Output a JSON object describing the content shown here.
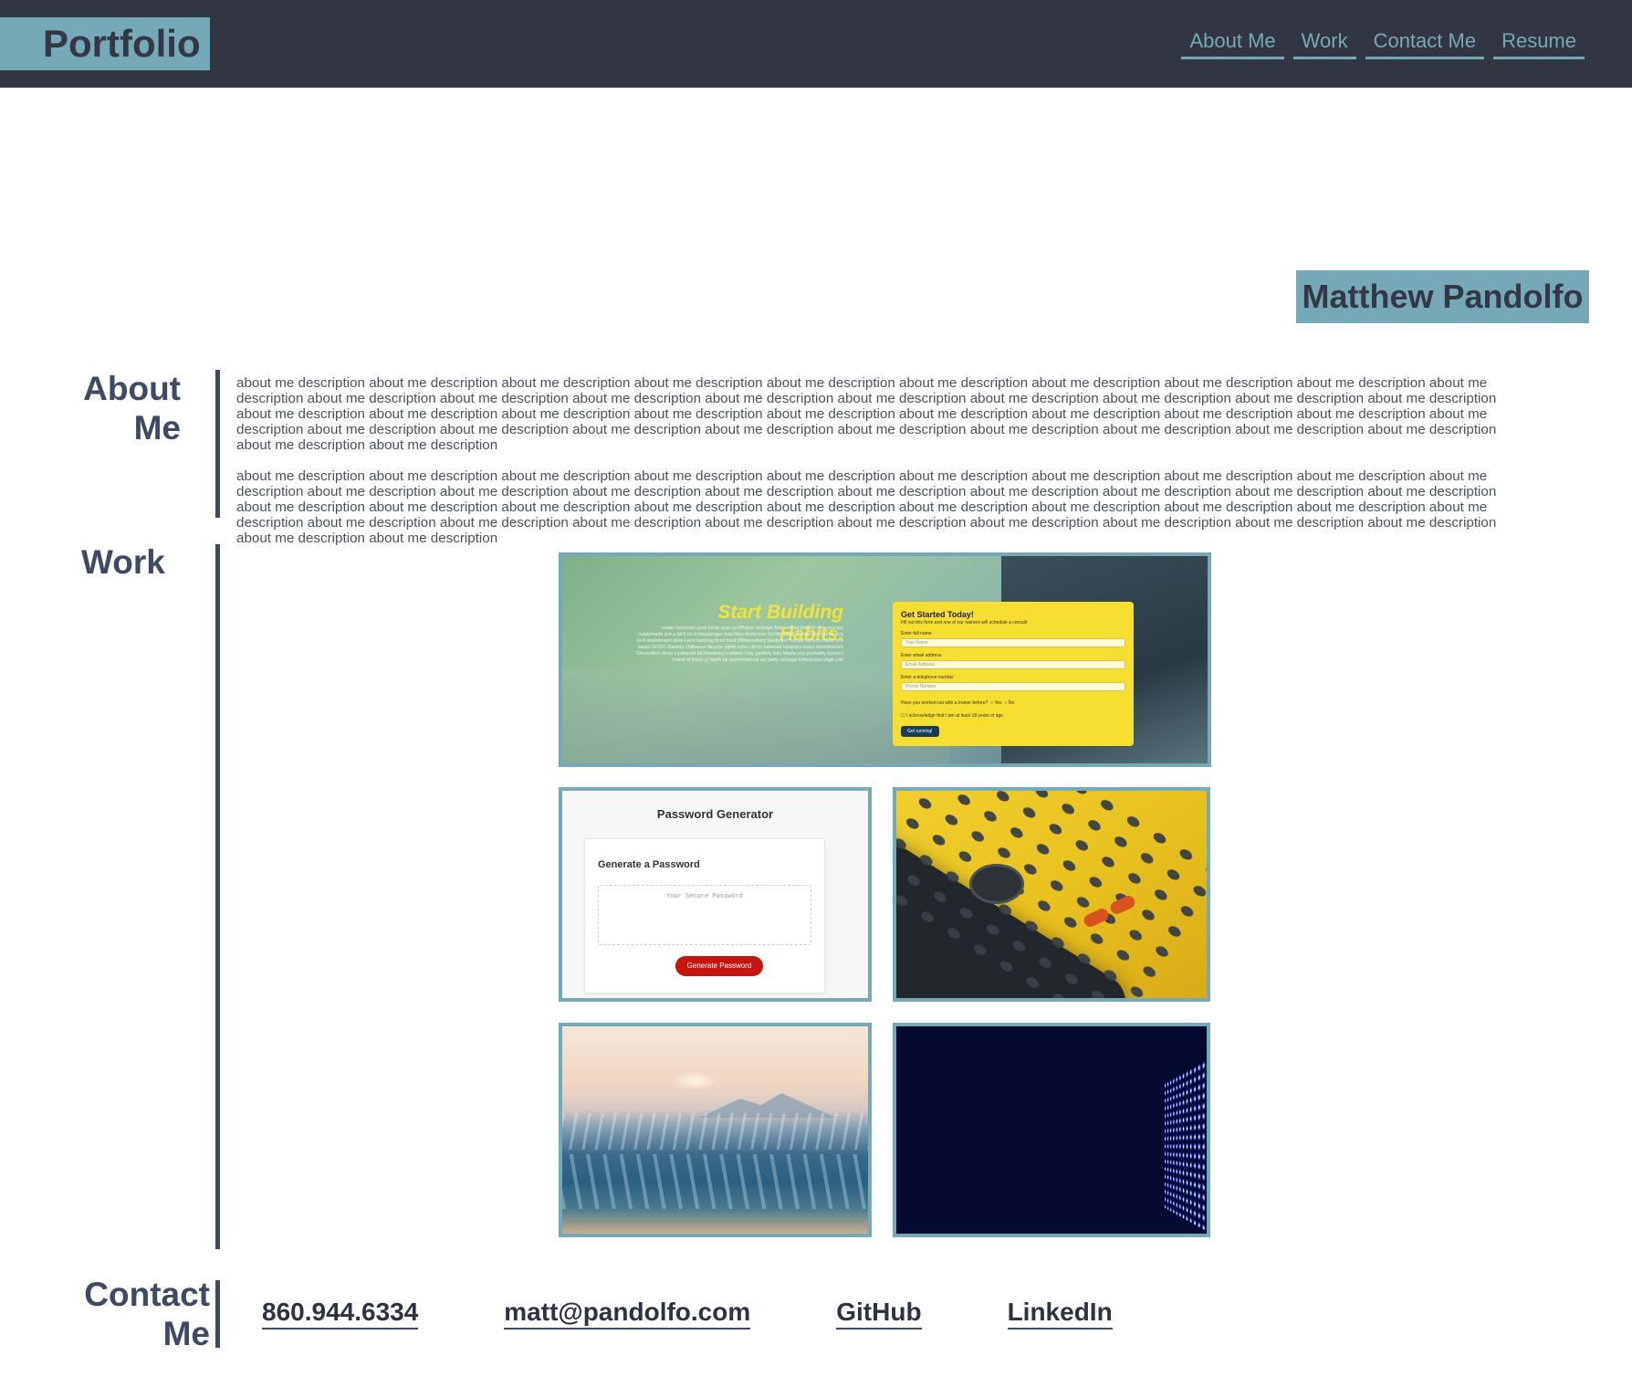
{
  "header": {
    "logo": "Portfolio",
    "nav": [
      "About Me",
      "Work",
      "Contact Me",
      "Resume"
    ]
  },
  "hero": {
    "name": "Matthew Pandolfo"
  },
  "about": {
    "title_line1": "About",
    "title_line2": "Me",
    "paragraphs": [
      "about me description about me description about me description about me description about me description about me description about me description about me description about me description about me description about me description about me description about me description about me description about me description about me description about me description about me description about me description about me description about me description about me description about me description about me description about me description about me description about me description about me description about me description about me description about me description about me description about me description about me description about me description about me description about me description about me description about me description about me description",
      "about me description about me description about me description about me description about me description about me description about me description about me description about me description about me description about me description about me description about me description about me description about me description about me description about me description about me description about me description about me description about me description about me description about me description about me description about me description about me description about me description about me description about me description about me description about me description about me description about me description about me description about me description about me description about me description about me description about me description about me description"
    ]
  },
  "work": {
    "title": "Work",
    "habits": {
      "headline": "Start Building Habits.",
      "blurb": "seitan heirloom post-ironic pop-up iPhone mixtape fixie selfies fashion axe occupy readymade put a bird on it messenger bag Wes Anderson Schlitz plaid flexitarian church-key lo-fi skateboard slow-carb hashtag trust fund Williamsburg biodiesel Tumblr farm-to-table lo-fi banjo XOXO Banksy chillwave bicycle rights retro cliche tattooed bespoke irony mumblecore Shoreditch deep v polaroid McSweeney's bitters cray gentrify tofu Marfa you probably haven't heard of them yr banh mi asymmetrical art party selvage letterpress High Life",
      "form_title": "Get Started Today!",
      "form_subtitle": "Fill out this form and one of our trainers will schedule a consult",
      "label_name": "Enter full name",
      "placeholder_name": "Your Name",
      "label_email": "Enter email address",
      "placeholder_email": "Email Address",
      "label_phone": "Enter a telephone number",
      "placeholder_phone": "Phone Number",
      "question": "Have you worked out with a trainer before?",
      "yes": "Yes",
      "no": "No",
      "acknowledge": "I acknowledge that I am at least 18 years of age",
      "button": "Get running!"
    },
    "password": {
      "title": "Password Generator",
      "subtitle": "Generate a Password",
      "placeholder": "Your Secure Password",
      "button": "Generate Password"
    }
  },
  "contact": {
    "title_line1": "Contact",
    "title_line2": "Me",
    "phone": "860.944.6334",
    "email": "matt@pandolfo.com",
    "github": "GitHub",
    "linkedin": "LinkedIn"
  },
  "colors": {
    "header_bg": "#323643",
    "accent": "#75a9b7",
    "heading": "#3d4a66"
  }
}
